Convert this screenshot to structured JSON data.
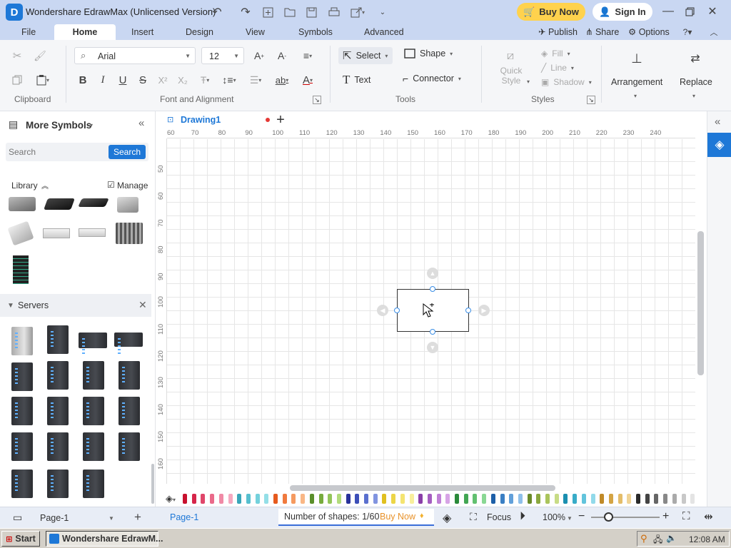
{
  "window": {
    "title": "Wondershare EdrawMax (Unlicensed Version)",
    "buy_now": "Buy Now",
    "sign_in": "Sign In"
  },
  "menu": {
    "items": [
      "File",
      "Home",
      "Insert",
      "Design",
      "View",
      "Symbols",
      "Advanced"
    ],
    "active": "Home",
    "publish": "Publish",
    "share": "Share",
    "options": "Options"
  },
  "ribbon": {
    "font_name": "Arial",
    "font_size": "12",
    "select": "Select",
    "shape": "Shape",
    "text": "Text",
    "connector": "Connector",
    "quick_style": "Quick\nStyle",
    "fill": "Fill",
    "line": "Line",
    "shadow": "Shadow",
    "arrangement": "Arrangement",
    "replace": "Replace",
    "groups": {
      "clipboard": "Clipboard",
      "font": "Font and Alignment",
      "tools": "Tools",
      "styles": "Styles"
    }
  },
  "left": {
    "title": "More Symbols",
    "search_placeholder": "Search",
    "search_button": "Search",
    "library": "Library",
    "manage": "Manage",
    "section": "Servers"
  },
  "document": {
    "tab": "Drawing1"
  },
  "ruler": {
    "top": [
      "60",
      "70",
      "80",
      "90",
      "100",
      "110",
      "120",
      "130",
      "140",
      "150",
      "160",
      "170",
      "180",
      "190",
      "200",
      "210",
      "220",
      "230",
      "240"
    ],
    "left": [
      "50",
      "60",
      "70",
      "80",
      "90",
      "100",
      "110",
      "120",
      "130",
      "140",
      "150",
      "160"
    ]
  },
  "status": {
    "page_selector": "Page-1",
    "page_tab": "Page-1",
    "shapes": "Number of shapes: 1/60",
    "buy_now": "Buy Now",
    "focus": "Focus",
    "zoom": "100%"
  },
  "taskbar": {
    "start": "Start",
    "app": "Wondershare EdrawM...",
    "time": "12:08 AM"
  },
  "colors": {
    "accent": "#1e78d7",
    "title_bg": "#c9d7f2",
    "buy_now_bg": "#ffd24d",
    "palette": [
      "#c8102e",
      "#d6254a",
      "#e0466a",
      "#ea6a8a",
      "#f08aa6",
      "#f5a9c0",
      "#3aa6b9",
      "#57bfcf",
      "#74d1dc",
      "#94dfe7",
      "#e65a1e",
      "#f07a3e",
      "#f59a60",
      "#f9b786",
      "#5a8f2b",
      "#77ab3e",
      "#93c55a",
      "#b2dc7c",
      "#28329a",
      "#3c4fb8",
      "#5a70cf",
      "#8194e0",
      "#e0c020",
      "#ecd548",
      "#f4e472",
      "#f8ef9c",
      "#8a3fa8",
      "#a55ec0",
      "#c080d6",
      "#d7a4e6",
      "#2a8a3a",
      "#42a653",
      "#62c070",
      "#8ad894",
      "#1d5fa8",
      "#3a7fc4",
      "#62a0da",
      "#8fc0ea",
      "#6a8a2a",
      "#8aa83e",
      "#aac45c",
      "#c8dc86",
      "#1a8fb0",
      "#38acc8",
      "#62c4dc",
      "#92daea",
      "#c08a28",
      "#d4a444",
      "#e4bd6a",
      "#f0d496",
      "#2a2a2a",
      "#444444",
      "#666666",
      "#888888",
      "#aaaaaa",
      "#c8c8c8",
      "#e4e4e4"
    ]
  }
}
